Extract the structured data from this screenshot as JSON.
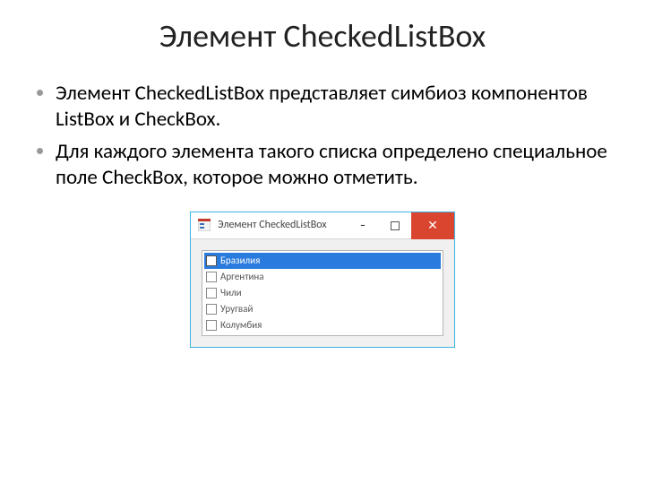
{
  "slide": {
    "title": "Элемент CheckedListBox",
    "bullets": [
      "Элемент CheckedListBox представляет симбиоз компонентов ListBox и CheckBox.",
      "Для каждого элемента такого списка определено специальное поле CheckBox, которое можно отметить."
    ]
  },
  "window": {
    "title": "Элемент CheckedListBox",
    "items": [
      {
        "label": "Бразилия",
        "checked": false,
        "selected": true
      },
      {
        "label": "Аргентина",
        "checked": false,
        "selected": false
      },
      {
        "label": "Чили",
        "checked": false,
        "selected": false
      },
      {
        "label": "Уругвай",
        "checked": false,
        "selected": false
      },
      {
        "label": "Колумбия",
        "checked": false,
        "selected": false
      }
    ]
  },
  "icons": {
    "close_glyph": "✕",
    "minimize_glyph": "–"
  },
  "colors": {
    "window_border": "#3eb6e8",
    "close_bg": "#d9452e",
    "selection_bg": "#2a7bde"
  }
}
